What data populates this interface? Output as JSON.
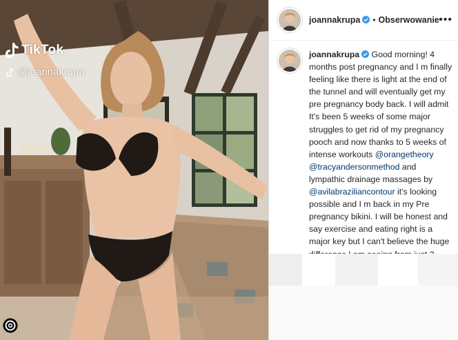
{
  "media": {
    "watermark_brand": "TikTok",
    "watermark_user": "@joannakrupa",
    "brand_icon": "tiktok-note-icon",
    "corner_icon": "threads-icon"
  },
  "header": {
    "username": "joannakrupa",
    "separator": "•",
    "follow_state": "Obserwowanie",
    "more_icon": "more-options-icon",
    "verified_color": "#3897f0"
  },
  "caption": {
    "username": "joannakrupa",
    "text_1": " Good morning! 4 months post pregnancy and I m finally feeling like there is light at the end of the tunnel and will eventually get my pre pregnancy body back. I will admit It's been 5 weeks of some major struggles to get rid of my pregnancy pooch and now thanks to 5 weeks of intense workouts ",
    "mention_1": "@orangetheory",
    "space_1": " ",
    "mention_2": "@tracyandersonmethod",
    "text_2": " and lympathic drainage massages by ",
    "mention_3": "@avilabraziliancontour",
    "text_3": " it's looking possible and I m back in my Pre pregnancy bikini. I will be honest and say exercise and eating right is a major key but I can't believe the huge difference I am seeing from just 2 Brazillian lympathic massage sessions this week . It's been a true",
    "mention_color": "#00376b"
  }
}
